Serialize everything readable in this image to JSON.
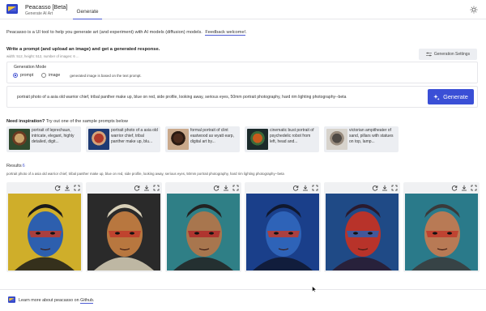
{
  "app": {
    "title": "Peacasso [Beta]",
    "subtitle": "Generate AI Art",
    "tab": "Generate"
  },
  "intro": {
    "text": "Peacasso is a UI tool to help you generate art (and experiment) with AI models (diffusion) models.",
    "link": "Feedback welcome!",
    "tail": "."
  },
  "prompt_section": {
    "title": "Write a prompt (and upload an image) and get a generated response.",
    "meta": "width: 512, height: 512, number of images: 6 ...",
    "settings_button": "Generation Settings"
  },
  "mode": {
    "label": "Generation Mode",
    "options": [
      "prompt",
      "image"
    ],
    "selected": "prompt",
    "hint": "generated image is based on the text prompt."
  },
  "prompt": {
    "value": "portrait photo of a asia old warrior chief, tribal panther make up, blue on red, side profile, looking away, serious eyes, 50mm portrait photography, hard rim lighting photography--beta",
    "generate_label": "Generate"
  },
  "inspiration": {
    "title_bold": "Need inspiration?",
    "title_rest": "Try out one of the sample prompts below",
    "samples": [
      {
        "text": "portrait of leprechaun, intricate, elegant, highly detailed, digit...",
        "colors": [
          "#2f4a2e",
          "#c9a36a",
          "#6b3b22"
        ]
      },
      {
        "text": "portrait photo of a asia old warrior chief, tribal panther make up, blu...",
        "colors": [
          "#1f3b74",
          "#b13a2b",
          "#d6a37a"
        ]
      },
      {
        "text": "formal portrait of clint eastwood as wyatt earp, digital art by...",
        "colors": [
          "#caa98b",
          "#4a2a1c",
          "#2a1a12"
        ]
      },
      {
        "text": "cinematic bust portrait of psychedelic robot from left, head and...",
        "colors": [
          "#1b2a2a",
          "#c85a1c",
          "#3a6a3a"
        ]
      },
      {
        "text": "victorian ampitheater of sand, pillars with statues on top, lamp...",
        "colors": [
          "#d7d3cc",
          "#4f4a45",
          "#9a8d7f"
        ]
      }
    ]
  },
  "results": {
    "label": "Results",
    "count": "6",
    "prompt": "portrait photo of a asia old warrior chief, tribal panther make up, blue on red, side profile, looking away, serious eyes, 50mm portrait photography, hard rim lighting photography--beta",
    "images": [
      {
        "bg": "#cfae2a",
        "skin": "#2d5fae",
        "paint": "#c0392b",
        "hair": "#1a1a1a"
      },
      {
        "bg": "#2a2a2a",
        "skin": "#b8773f",
        "paint": "#c0392b",
        "hair": "#d8d0b8"
      },
      {
        "bg": "#2f7f86",
        "skin": "#a8764e",
        "paint": "#b02a2a",
        "hair": "#222"
      },
      {
        "bg": "#1a3f8a",
        "skin": "#2e63b8",
        "paint": "#c0392b",
        "hair": "#10182e"
      },
      {
        "bg": "#1f4a86",
        "skin": "#b8332a",
        "paint": "#2d5fae",
        "hair": "#2a1a2e"
      },
      {
        "bg": "#2a7a8a",
        "skin": "#b87a55",
        "paint": "#c0392b",
        "hair": "#3a3a3a"
      }
    ]
  },
  "footer": {
    "text": "Learn more about peacasso on",
    "link": "Github",
    "tail": "."
  },
  "colors": {
    "accent": "#3a4fd6",
    "panel": "#eceef2"
  }
}
